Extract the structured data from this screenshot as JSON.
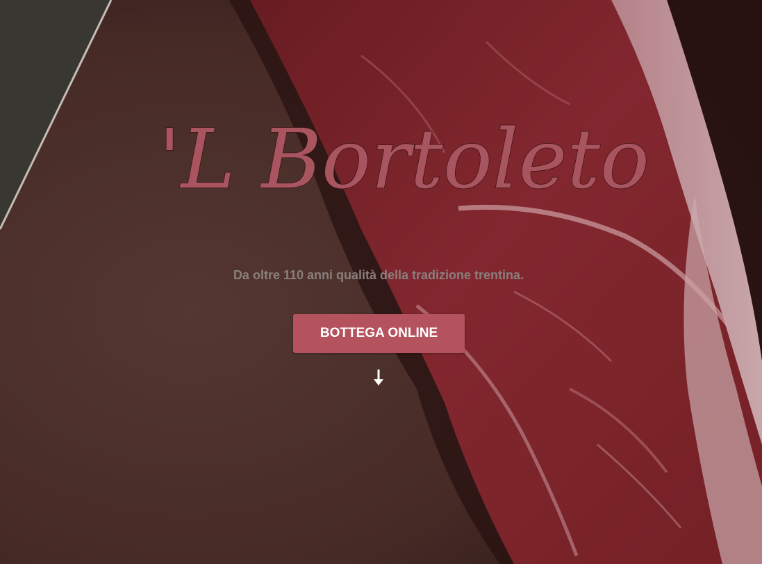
{
  "brand": {
    "name": "'L Bortoleto"
  },
  "hero": {
    "tagline": "Da oltre 110 anni qualità della tradizione trentina.",
    "cta_label": "BOTTEGA ONLINE",
    "scroll_icon": "arrow-down-icon"
  },
  "colors": {
    "accent": "#b4525d",
    "brand_text": "#a85560",
    "tagline": "#8a7f7d"
  }
}
